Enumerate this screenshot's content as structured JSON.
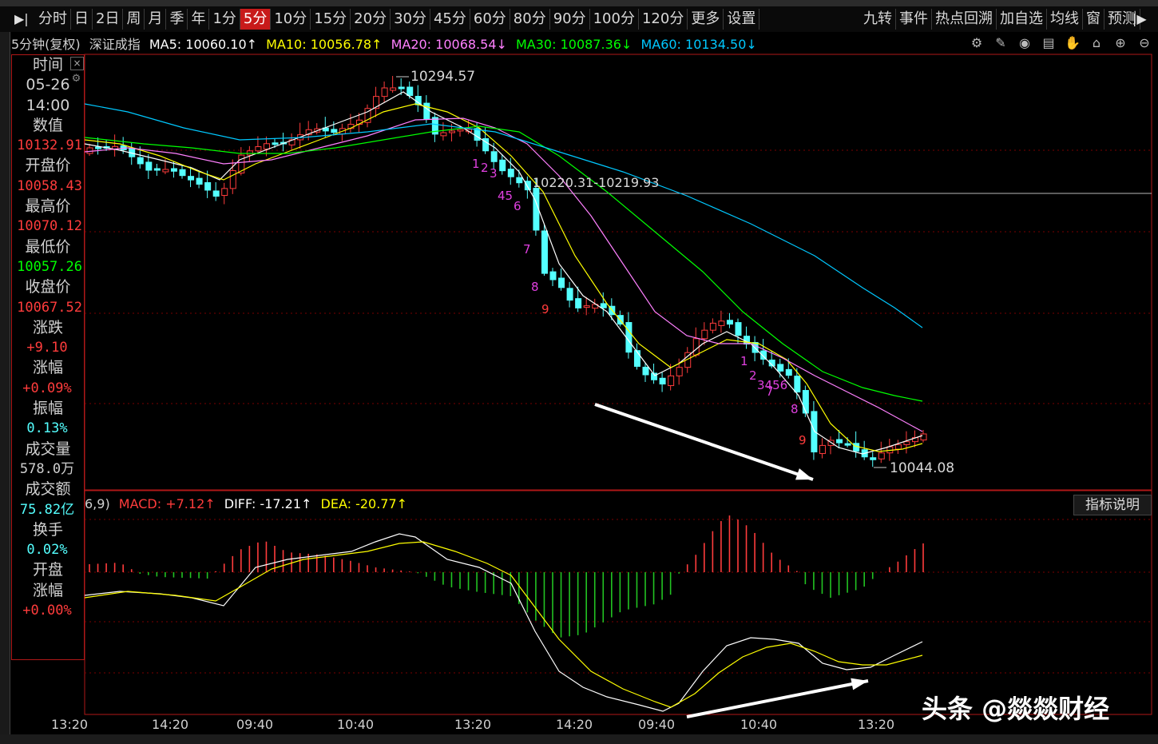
{
  "toolbar": {
    "periods": [
      "分时",
      "日",
      "2日",
      "周",
      "月",
      "季",
      "年",
      "1分",
      "5分",
      "10分",
      "15分",
      "20分",
      "30分",
      "45分",
      "60分",
      "80分",
      "90分",
      "100分",
      "120分",
      "更多",
      "设置"
    ],
    "active_period": "5分",
    "right_buttons": [
      "九转",
      "事件",
      "热点回溯",
      "加自选",
      "均线",
      "窗",
      "预测"
    ]
  },
  "info": {
    "period_label": "5分钟(复权)",
    "name": "深证成指",
    "ma5": "MA5: 10060.10↑",
    "ma10": "MA10: 10056.78↑",
    "ma20": "MA20: 10068.54↓",
    "ma30": "MA30: 10087.36↓",
    "ma60": "MA60: 10134.50↓"
  },
  "panel": {
    "time_label": "时间",
    "date": "05-26",
    "time": "14:00",
    "value_label": "数值",
    "value": "10132.91",
    "open_label": "开盘价",
    "open": "10058.43",
    "high_label": "最高价",
    "high": "10070.12",
    "low_label": "最低价",
    "low": "10057.26",
    "close_label": "收盘价",
    "close": "10067.52",
    "chg_label": "涨跌",
    "chg": "+9.10",
    "pct_label": "涨幅",
    "pct": "+0.09%",
    "amp_label": "振幅",
    "amp": "0.13%",
    "vol_label": "成交量",
    "vol": "578.0万",
    "amt_label": "成交额",
    "amt": "75.82亿",
    "turn_label": "换手",
    "turn": "0.02%",
    "open_pct_label1": "开盘",
    "open_pct_label2": "涨幅",
    "open_pct": "+0.00%"
  },
  "annotations": {
    "high": "10294.57",
    "low": "10044.08",
    "level": "10220.31-10219.93"
  },
  "macd": {
    "params": "6,9)",
    "macd": "MACD: +7.12↑",
    "diff": "DIFF: -17.21↑",
    "dea": "DEA: -20.77↑",
    "help_button": "指标说明"
  },
  "time_axis": [
    "13:20",
    "14:20",
    "09:40",
    "10:40",
    "13:20",
    "14:20",
    "09:40",
    "10:40",
    "13:20"
  ],
  "watermark": "头条 @燚燚财经",
  "colors": {
    "up": "#ff3c3c",
    "down": "#54ffff",
    "ma5": "#ffffff",
    "ma10": "#ffff00",
    "ma20": "#ff80ff",
    "ma30": "#00ff00",
    "ma60": "#00c8ff",
    "grid": "#8a0000"
  },
  "chart_data": {
    "type": "candlestick",
    "title": "深证成指",
    "period": "5分钟",
    "price_range": [
      10044.08,
      10294.57
    ],
    "labeled_high": 10294.57,
    "labeled_low": 10044.08,
    "horizontal_level": 10220.31,
    "nine_turn_sequences": [
      [
        "1",
        "2",
        "3",
        "45",
        "6",
        "7",
        "8",
        "9"
      ],
      [
        "1",
        "2",
        "3456",
        "7",
        "8",
        "9"
      ]
    ],
    "ma_values": {
      "MA5": 10060.1,
      "MA10": 10056.78,
      "MA20": 10068.54,
      "MA30": 10087.36,
      "MA60": 10134.5
    },
    "macd_values": {
      "MACD": 7.12,
      "DIFF": -17.21,
      "DEA": -20.77
    }
  }
}
